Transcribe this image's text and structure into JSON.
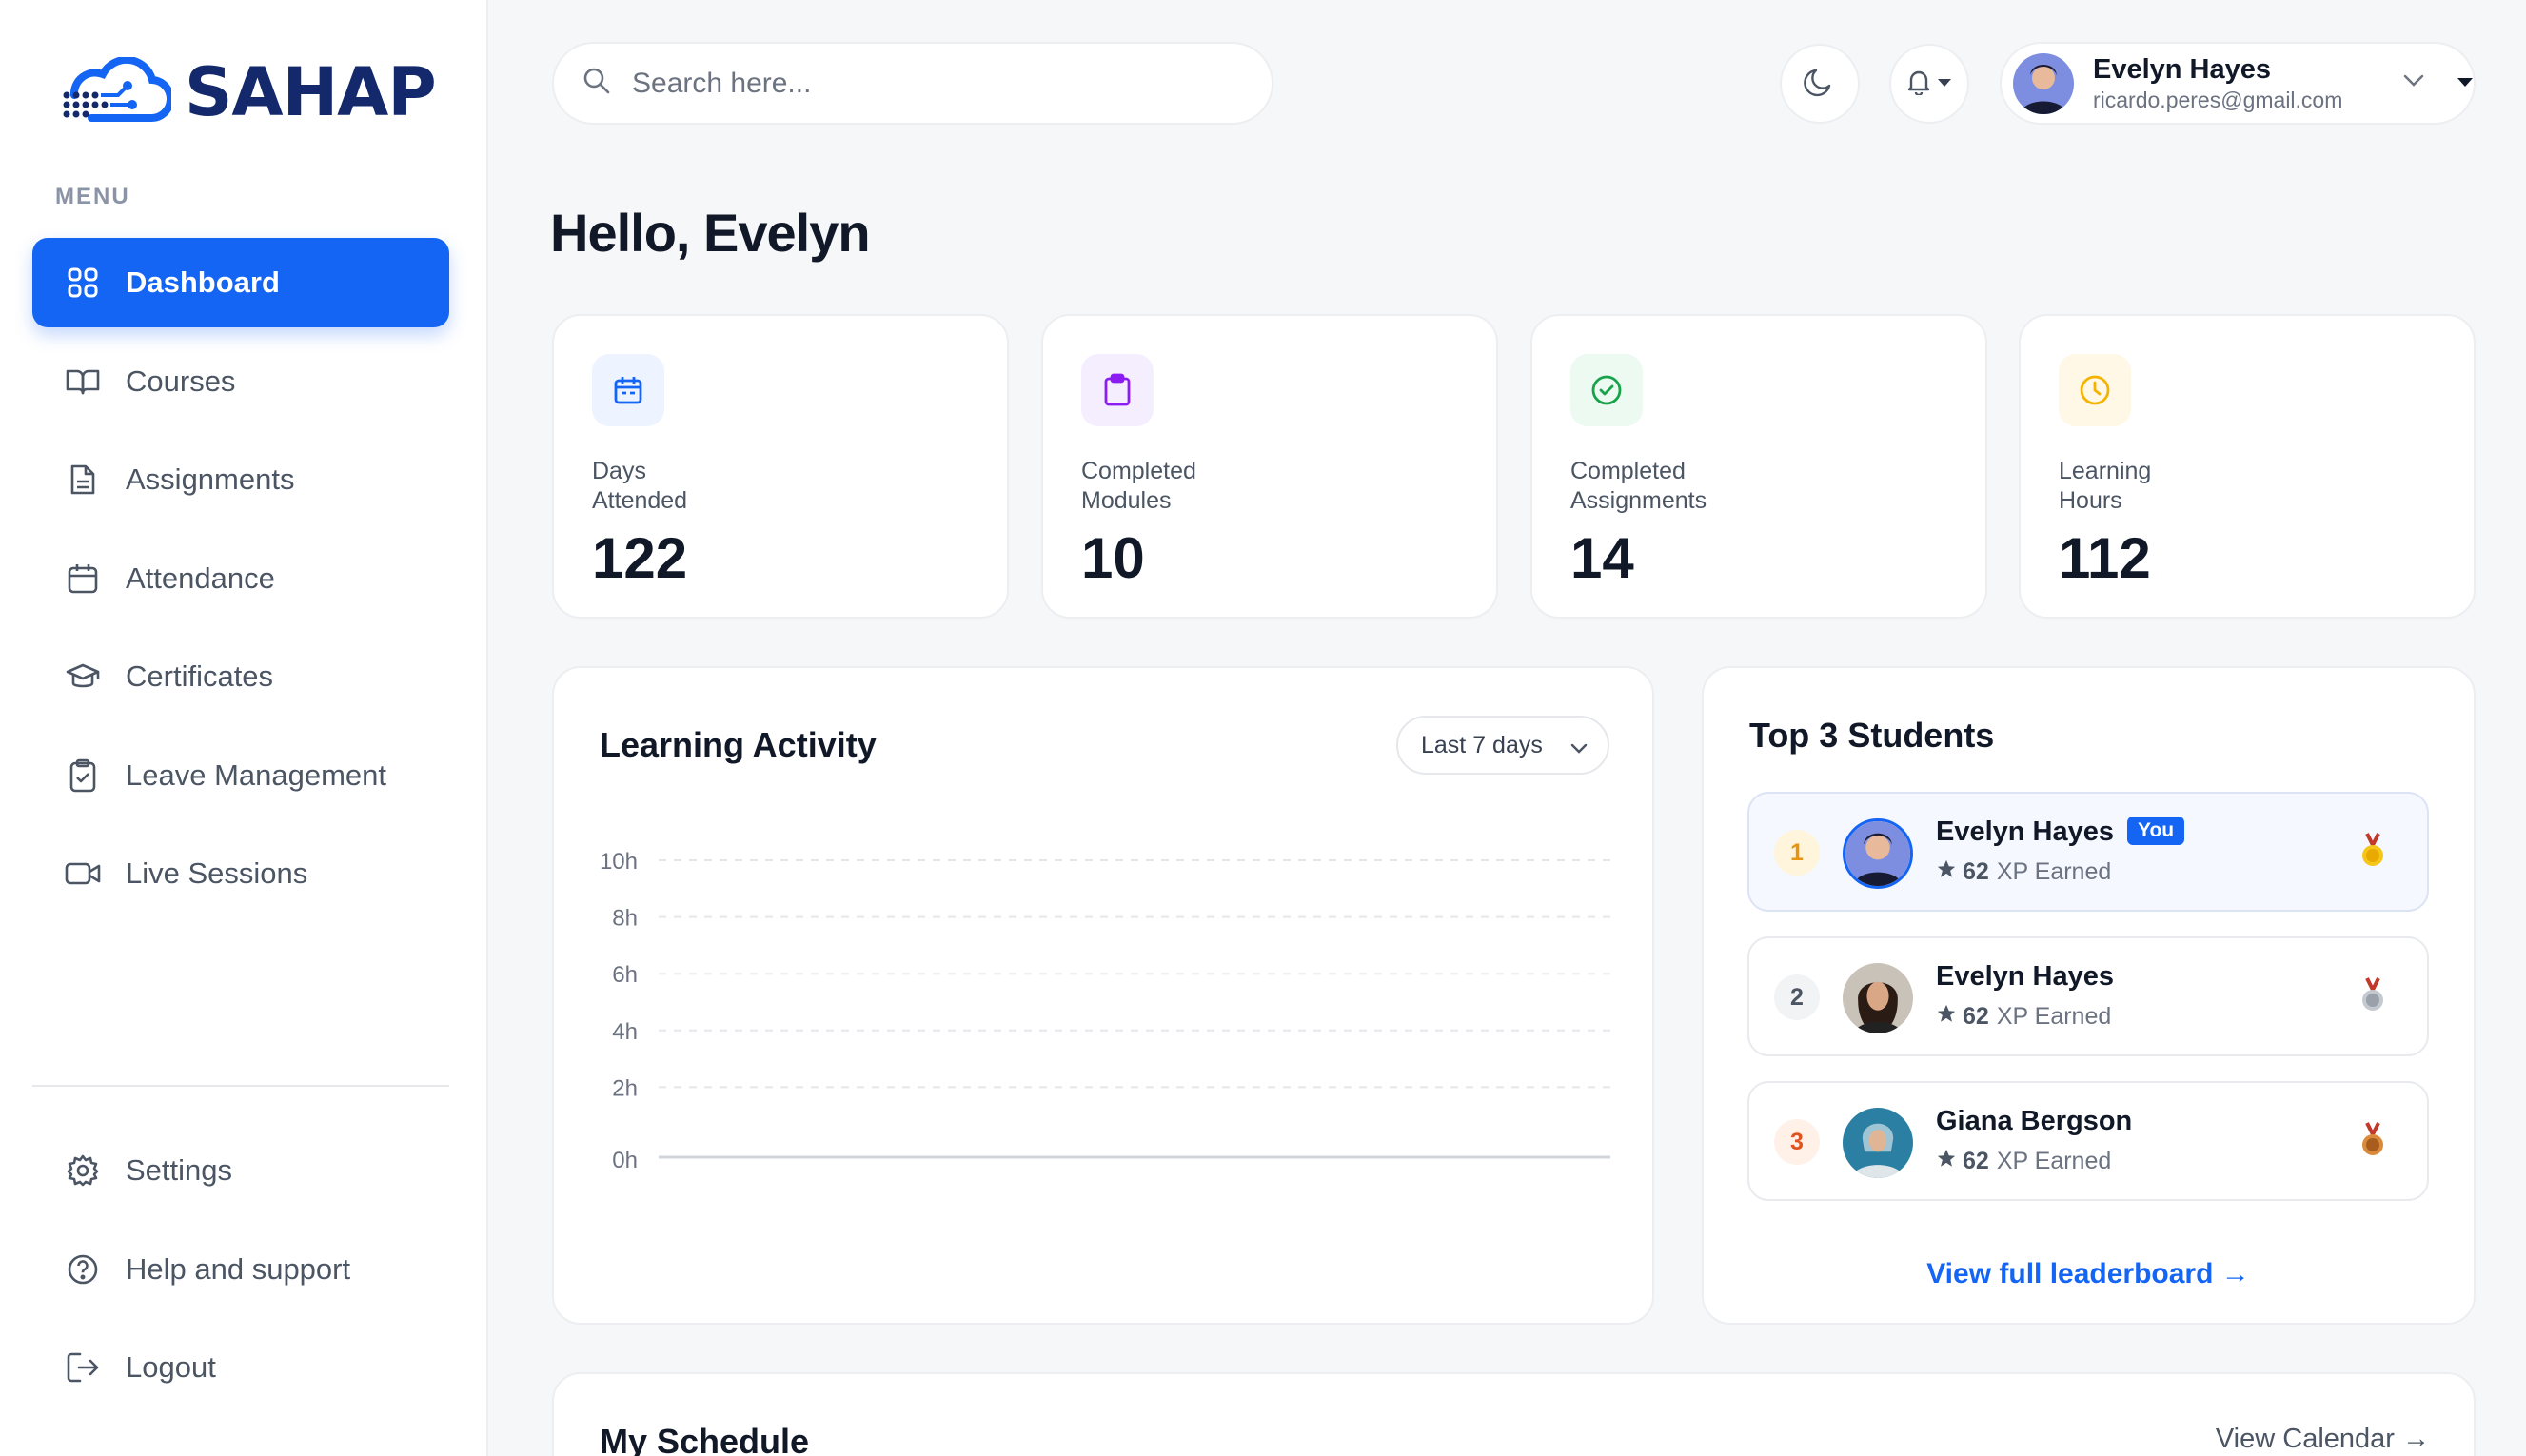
{
  "brand": {
    "name": "SAHAP",
    "color": "#1565f5",
    "text_color": "#13296b"
  },
  "sidebar": {
    "menu_label": "MENU",
    "items": [
      {
        "label": "Dashboard",
        "icon": "grid-icon",
        "active": true
      },
      {
        "label": "Courses",
        "icon": "book-open-icon"
      },
      {
        "label": "Assignments",
        "icon": "file-text-icon"
      },
      {
        "label": "Attendance",
        "icon": "calendar-icon"
      },
      {
        "label": "Certificates",
        "icon": "graduation-cap-icon"
      },
      {
        "label": "Leave Management",
        "icon": "clipboard-check-icon"
      },
      {
        "label": "Live Sessions",
        "icon": "video-icon"
      }
    ],
    "bottom_items": [
      {
        "label": "Settings",
        "icon": "gear-icon"
      },
      {
        "label": "Help and support",
        "icon": "help-circle-icon"
      },
      {
        "label": "Logout",
        "icon": "logout-icon"
      }
    ]
  },
  "header": {
    "search_placeholder": "Search here...",
    "user": {
      "name": "Evelyn Hayes",
      "email": "ricardo.peres@gmail.com"
    }
  },
  "greeting": "Hello, Evelyn",
  "stats": [
    {
      "label_line1": "Days",
      "label_line2": "Attended",
      "value": "122",
      "icon": "calendar-icon",
      "color": "#1565f5",
      "bg": "#eef4ff"
    },
    {
      "label_line1": "Completed",
      "label_line2": "Modules",
      "value": "10",
      "icon": "clipboard-icon",
      "color": "#8b1df2",
      "bg": "#f5eeff"
    },
    {
      "label_line1": "Completed",
      "label_line2": "Assignments",
      "value": "14",
      "icon": "check-circle-icon",
      "color": "#16a34a",
      "bg": "#edfaf1"
    },
    {
      "label_line1": "Learning",
      "label_line2": "Hours",
      "value": "112",
      "icon": "clock-icon",
      "color": "#f5b301",
      "bg": "#fff8e6"
    }
  ],
  "activity": {
    "title": "Learning Activity",
    "range": "Last 7 days"
  },
  "chart_data": {
    "type": "line",
    "title": "Learning Activity",
    "y_ticks": [
      "10h",
      "8h",
      "6h",
      "4h",
      "2h",
      "0h"
    ],
    "ylim": [
      0,
      10
    ],
    "grid": true,
    "series": []
  },
  "leaderboard": {
    "title": "Top 3 Students",
    "you_label": "You",
    "xp_suffix": "XP Earned",
    "students": [
      {
        "rank": "1",
        "name": "Evelyn Hayes",
        "xp": "62",
        "is_you": true,
        "rank_color": "#e8940c",
        "rank_bg": "#fff4dc",
        "medal": "gold-medal-icon"
      },
      {
        "rank": "2",
        "name": "Evelyn Hayes",
        "xp": "62",
        "is_you": false,
        "rank_color": "#4b5563",
        "rank_bg": "#f1f3f5",
        "medal": "silver-medal-icon"
      },
      {
        "rank": "3",
        "name": "Giana Bergson",
        "xp": "62",
        "is_you": false,
        "rank_color": "#e0531f",
        "rank_bg": "#fff0e8",
        "medal": "bronze-medal-icon"
      }
    ],
    "link": "View full leaderboard →"
  },
  "schedule": {
    "title": "My Schedule",
    "link": "View Calendar →"
  }
}
